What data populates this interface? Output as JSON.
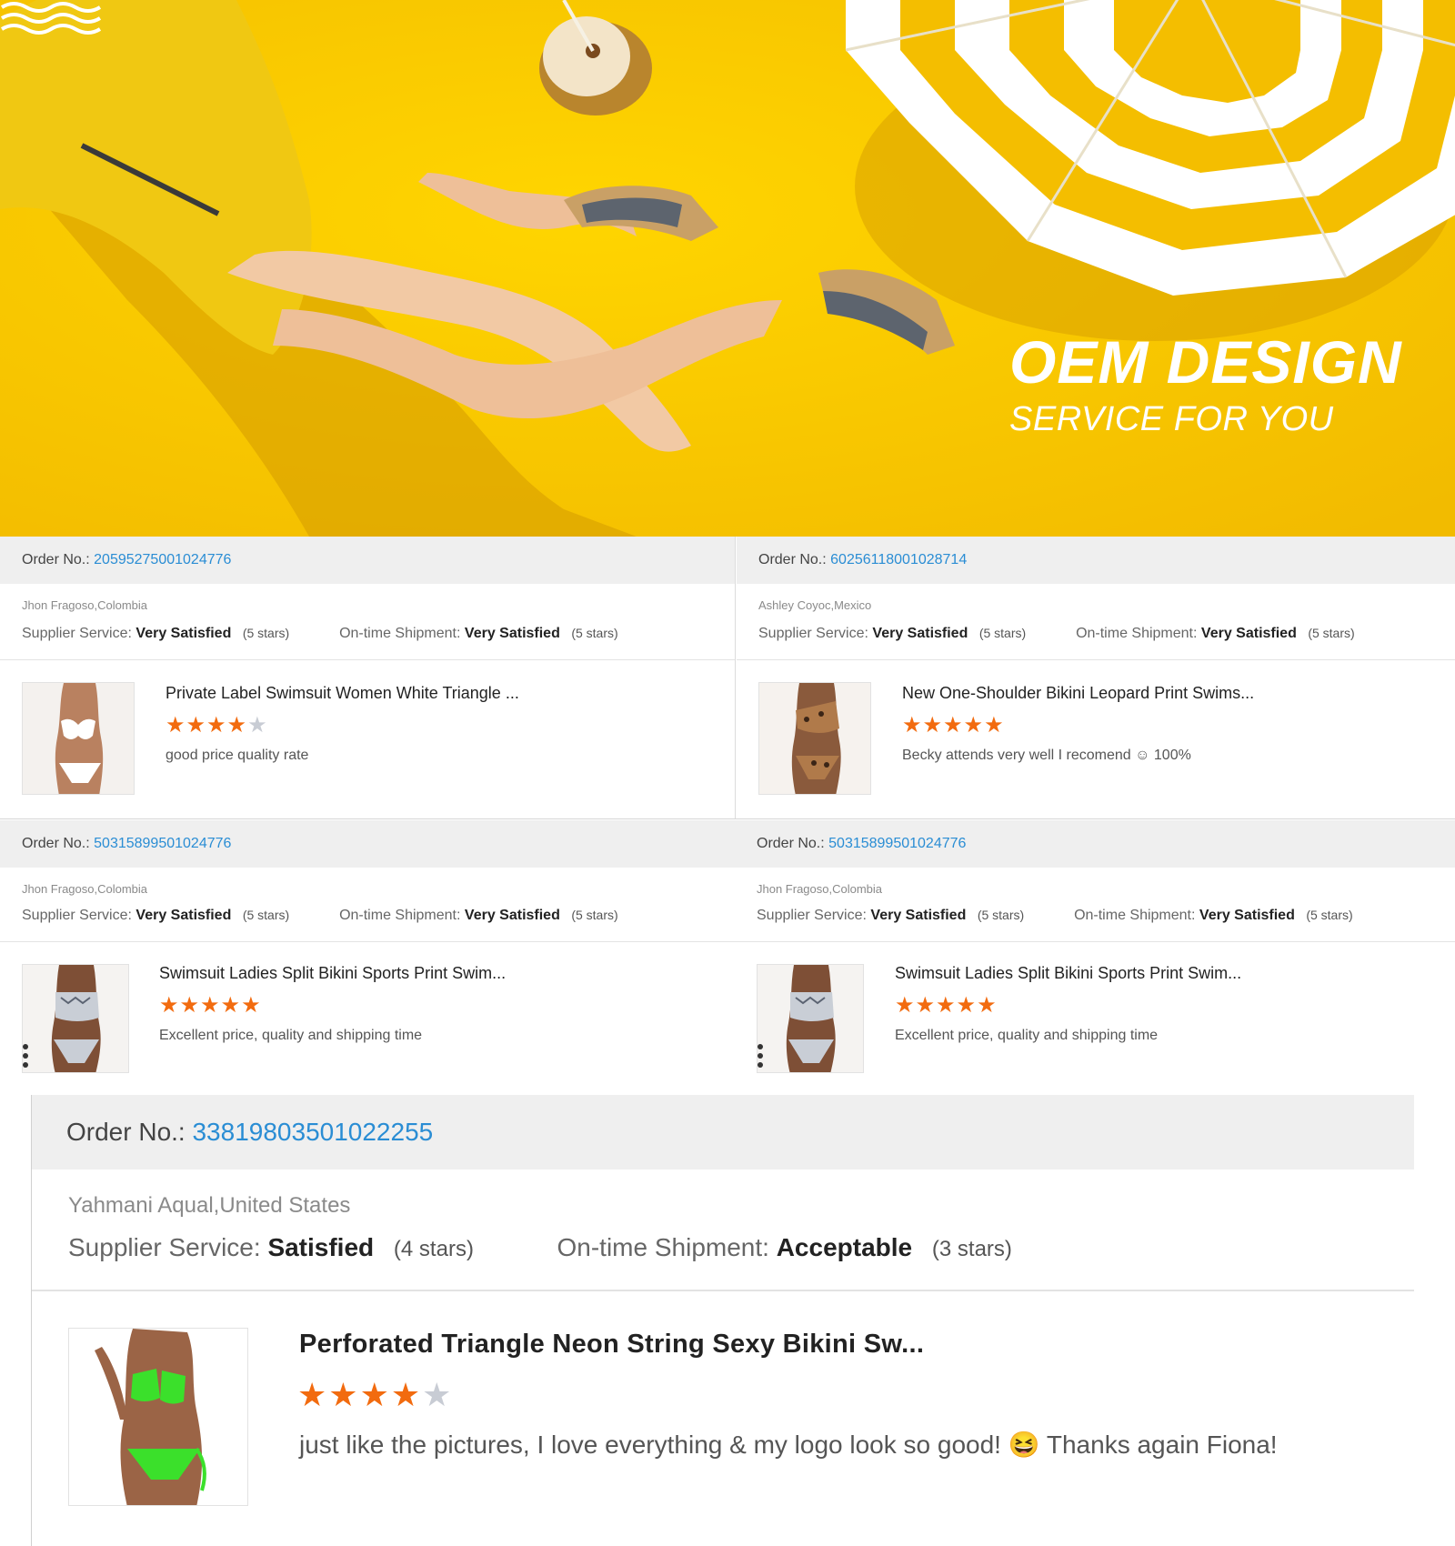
{
  "banner": {
    "title": "OEM DESIGN",
    "subtitle": "SERVICE FOR YOU",
    "colors": {
      "background": "#f7c700",
      "text": "#ffffff"
    }
  },
  "labels": {
    "order_no": "Order No.:",
    "supplier_service": "Supplier Service:",
    "on_time_shipment": "On-time Shipment:"
  },
  "colors": {
    "accent_link": "#2a8dd4",
    "star": "#f26b0f",
    "star_empty": "#c8ccd4"
  },
  "reviews": [
    {
      "order_no": "20595275001024776",
      "buyer": "Jhon Fragoso,Colombia",
      "supplier_value": "Very Satisfied",
      "supplier_stars": "(5 stars)",
      "shipment_value": "Very Satisfied",
      "shipment_stars": "(5 stars)",
      "product_title": "Private Label Swimsuit Women White Triangle ...",
      "rating": 4,
      "comment": "good price quality rate",
      "thumb_icon": "white-bikini-photo"
    },
    {
      "order_no": "60256118001028714",
      "buyer": "Ashley Coyoc,Mexico",
      "supplier_value": "Very Satisfied",
      "supplier_stars": "(5 stars)",
      "shipment_value": "Very Satisfied",
      "shipment_stars": "(5 stars)",
      "product_title": "New One-Shoulder Bikini Leopard Print Swims...",
      "rating": 5,
      "comment": "Becky attends very well I recomend ☺ 100%",
      "thumb_icon": "leopard-bikini-photo"
    },
    {
      "order_no": "50315899501024776",
      "buyer": "Jhon Fragoso,Colombia",
      "supplier_value": "Very Satisfied",
      "supplier_stars": "(5 stars)",
      "shipment_value": "Very Satisfied",
      "shipment_stars": "(5 stars)",
      "product_title": "Swimsuit Ladies Split Bikini Sports Print Swim...",
      "rating": 5,
      "comment": "Excellent price, quality and shipping time",
      "thumb_icon": "snake-print-bikini-photo"
    },
    {
      "order_no": "50315899501024776",
      "buyer": "Jhon Fragoso,Colombia",
      "supplier_value": "Very Satisfied",
      "supplier_stars": "(5 stars)",
      "shipment_value": "Very Satisfied",
      "shipment_stars": "(5 stars)",
      "product_title": "Swimsuit Ladies Split Bikini Sports Print Swim...",
      "rating": 5,
      "comment": "Excellent price, quality and shipping time",
      "thumb_icon": "snake-print-bikini-photo"
    },
    {
      "order_no": "33819803501022255",
      "buyer": "Yahmani Aqual,United States",
      "supplier_value": "Satisfied",
      "supplier_stars": "(4 stars)",
      "shipment_value": "Acceptable",
      "shipment_stars": "(3 stars)",
      "product_title": "Perforated Triangle Neon String Sexy Bikini Sw...",
      "rating": 4,
      "comment": "just like the pictures, I love everything & my logo look so good! 😆 Thanks again Fiona!",
      "thumb_icon": "neon-green-bikini-photo"
    }
  ]
}
